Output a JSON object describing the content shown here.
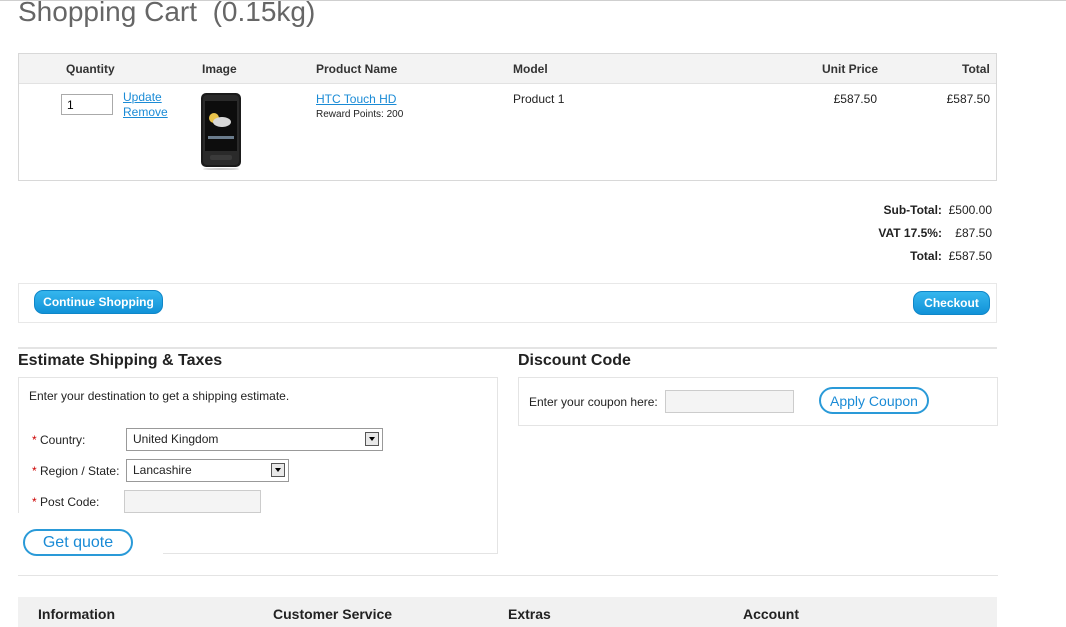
{
  "page": {
    "title": "Shopping Cart  (0.15kg)"
  },
  "cart": {
    "columns": [
      "Quantity",
      "Image",
      "Product Name",
      "Model",
      "Unit Price",
      "Total"
    ],
    "row": {
      "quantity": "1",
      "update_label": "Update",
      "remove_label": "Remove",
      "image_icon": "phone-icon",
      "product_name": "HTC Touch HD",
      "reward_points": "Reward Points: 200",
      "model": "Product 1",
      "unit_price": "£587.50",
      "total": "£587.50"
    }
  },
  "totals": [
    {
      "label": "Sub-Total:",
      "value": "£500.00"
    },
    {
      "label": "VAT 17.5%:",
      "value": "£87.50"
    },
    {
      "label": "Total:",
      "value": "£587.50"
    }
  ],
  "buttons": {
    "continue": "Continue Shopping",
    "checkout": "Checkout"
  },
  "shipping": {
    "title": "Estimate Shipping & Taxes",
    "intro": "Enter your destination to get a shipping estimate.",
    "required_mark": "*",
    "country_label": "Country:",
    "country_value": "United Kingdom",
    "region_label": "Region / State:",
    "region_value": "Lancashire",
    "postcode_label": "Post Code:",
    "postcode_value": "",
    "quote_button": "Get quote"
  },
  "discount": {
    "title": "Discount Code",
    "label": "Enter your coupon here:",
    "coupon_value": "",
    "apply_button": "Apply Coupon"
  },
  "footer": {
    "headings": [
      "Information",
      "Customer Service",
      "Extras",
      "Account"
    ]
  },
  "colors": {
    "accent": "#1a8bd6",
    "button": "#1192d8",
    "required": "#cc0000"
  }
}
